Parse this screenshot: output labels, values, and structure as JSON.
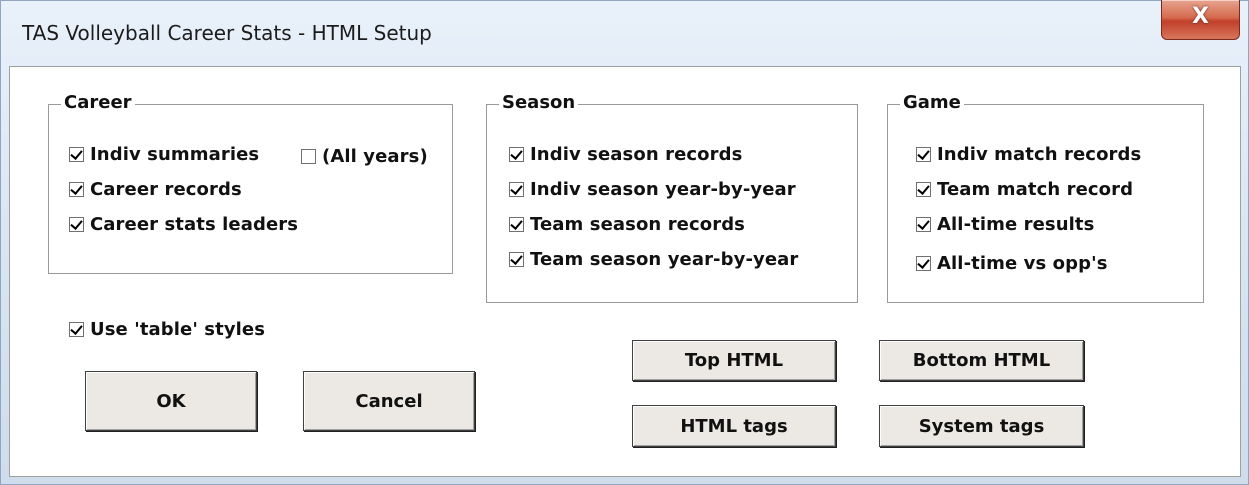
{
  "window": {
    "title": "TAS Volleyball Career Stats - HTML Setup",
    "close_glyph": "X"
  },
  "groups": {
    "career": {
      "label": "Career",
      "options": [
        {
          "label": "Indiv summaries",
          "checked": true
        },
        {
          "label": "(All years)",
          "checked": false
        },
        {
          "label": "Career records",
          "checked": true
        },
        {
          "label": "Career stats leaders",
          "checked": true
        }
      ]
    },
    "season": {
      "label": "Season",
      "options": [
        {
          "label": "Indiv season records",
          "checked": true
        },
        {
          "label": "Indiv season year-by-year",
          "checked": true
        },
        {
          "label": "Team season records",
          "checked": true
        },
        {
          "label": "Team season year-by-year",
          "checked": true
        }
      ]
    },
    "game": {
      "label": "Game",
      "options": [
        {
          "label": "Indiv match records",
          "checked": true
        },
        {
          "label": "Team match record",
          "checked": true
        },
        {
          "label": "All-time results",
          "checked": true
        },
        {
          "label": "All-time vs opp's",
          "checked": true
        }
      ]
    }
  },
  "use_table_styles": {
    "label": "Use 'table' styles",
    "checked": true
  },
  "buttons": {
    "ok": "OK",
    "cancel": "Cancel",
    "top_html": "Top HTML",
    "bottom_html": "Bottom HTML",
    "html_tags": "HTML tags",
    "system_tags": "System tags"
  }
}
